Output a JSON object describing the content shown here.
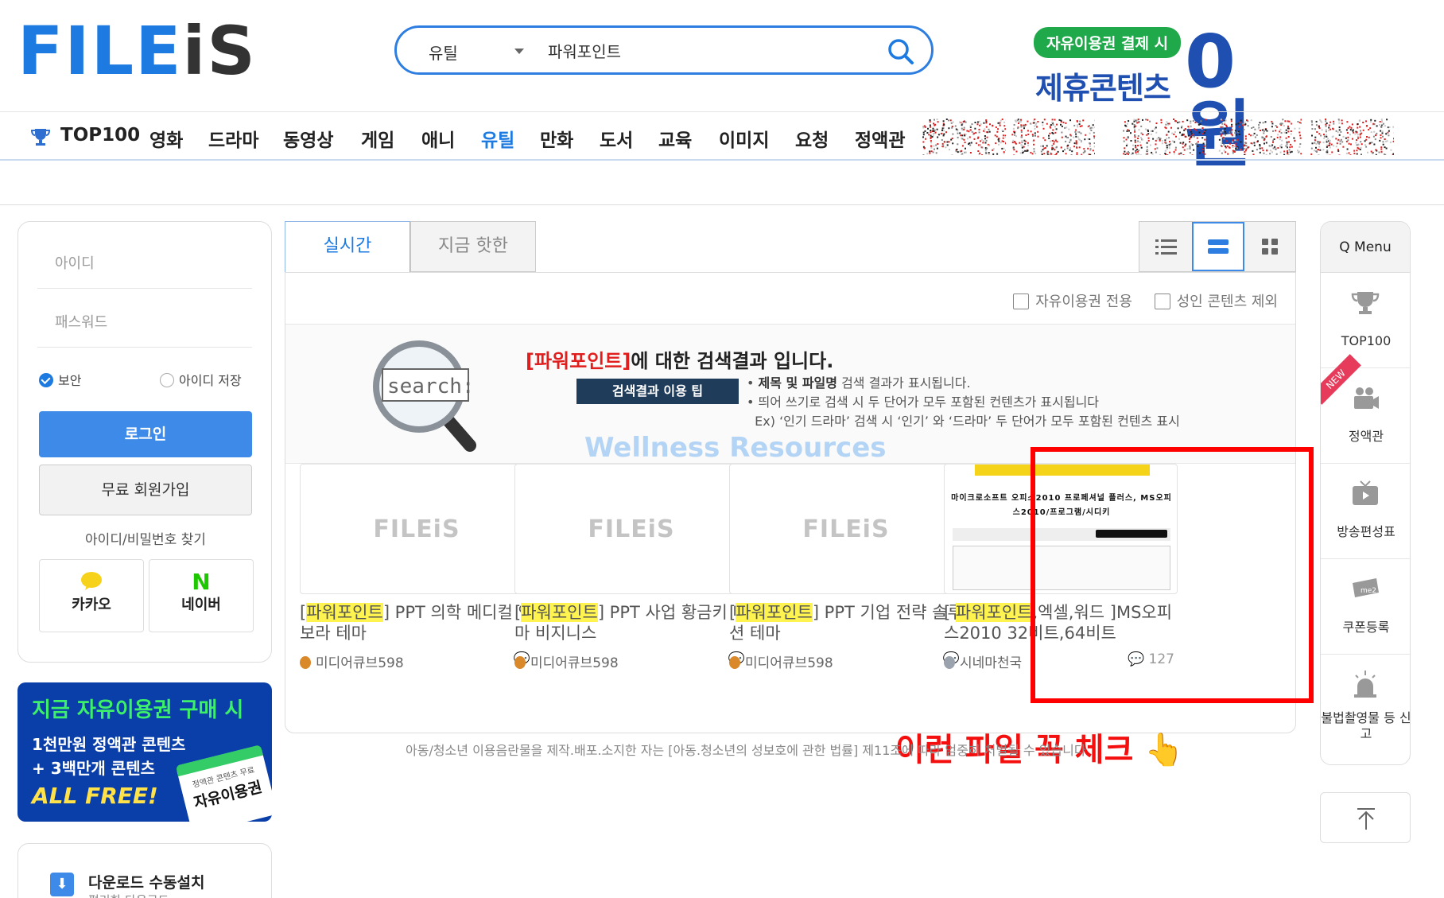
{
  "header": {
    "logo": "FILEiS",
    "search": {
      "category": "유틸",
      "query": "파워포인트"
    },
    "promo": {
      "pill": "자유이용권 결제 시",
      "big": "제휴콘텐츠",
      "zero": "0원"
    }
  },
  "nav": [
    "TOP100",
    "영화",
    "드라마",
    "동영상",
    "게임",
    "애니",
    "유틸",
    "만화",
    "도서",
    "교육",
    "이미지",
    "요청",
    "정액관"
  ],
  "nav_active": "유틸",
  "login": {
    "id_placeholder": "아이디",
    "pw_placeholder": "패스워드",
    "secure": "보안",
    "save_id": "아이디 저장",
    "login_btn": "로그인",
    "join_btn": "무료 회원가입",
    "find": "아이디/비밀번호 찾기",
    "kakao": "카카오",
    "naver": "네이버"
  },
  "banner": {
    "l1": "지금 자유이용권 구매 시",
    "l2": "1천만원 정액관 콘텐츠",
    "l3": "+ 3백만개 콘텐츠",
    "l4": "ALL FREE!",
    "ticket_small": "정액관 콘텐츠 무료",
    "ticket_big": "자유이용권"
  },
  "download": {
    "title": "다운로드 수동설치",
    "sub": "편리한 다운로드"
  },
  "tabs": {
    "realtime": "실시간",
    "hot": "지금 핫한"
  },
  "filters": {
    "free_only": "자유이용권 전용",
    "exclude_adult": "성인 콘텐츠 제외"
  },
  "result": {
    "keyword": "[파워포인트]",
    "title_rest": "에 대한 검색결과 입니다.",
    "tip_badge": "검색결과 이용 팁",
    "tip1_bold": "제목 및 파일명",
    "tip1_rest": " 검색 결과가 표시됩니다.",
    "tip2": "띄어 쓰기로 검색 시 두 단어가 모두 포함된 컨텐츠가 표시됩니다",
    "tip3": "Ex) ‘인기 드라마’ 검색 시 ‘인기’ 와 ‘드라마’ 두 단어가 모두 포함된 컨텐츠 표시",
    "search_img_text": "search:"
  },
  "watermark": "Wellness Resources",
  "cards": [
    {
      "thumb": "FILEiS",
      "pre": "[",
      "hl": "파워포인트",
      "post": "] PPT 의학 메디컬 연보라 테마",
      "uploader": "미디어큐브598",
      "comments": "",
      "medal": "#d9882a"
    },
    {
      "thumb": "FILEiS",
      "pre": "[",
      "hl": "파워포인트",
      "post": "] PPT 사업 황금키 테마 비지니스",
      "uploader": "미디어큐브598",
      "comments": "",
      "medal": "#d9882a"
    },
    {
      "thumb": "FILEiS",
      "pre": "[",
      "hl": "파워포인트",
      "post": "] PPT 기업 전략 솔루션 테마",
      "uploader": "미디어큐브598",
      "comments": "",
      "medal": "#d9882a"
    },
    {
      "thumb": "",
      "thumb_title": "마이크로소프트 오피스2010 프로페셔널 플러스, MS오피스2010/프로그램/시디키",
      "pre": "[ ",
      "hl": "파워포인트",
      "post": ",엑셀,워드 ]MS오피스2010 32비트,64비트",
      "uploader": "시네마천국",
      "comments": "127",
      "medal": "#9aa3ad"
    }
  ],
  "annotation": "이런 파일 꼭 체크 👆",
  "footer_note": "아동/청소년 이용음란물을 제작.배포.소지한 자는 [아동.청소년의 성보호에 관한 법률] 제11조에 따라 엄중히 처벌될 수 있습니다",
  "qmenu": {
    "title": "Q Menu",
    "items": [
      "TOP100",
      "정액관",
      "방송편성표",
      "쿠폰등록",
      "불법촬영물 등 신고"
    ],
    "new_tag": "NEW"
  },
  "colors": {
    "brand": "#1c7ae0",
    "highlight": "#fff44f",
    "annotation": "#ff0000"
  }
}
